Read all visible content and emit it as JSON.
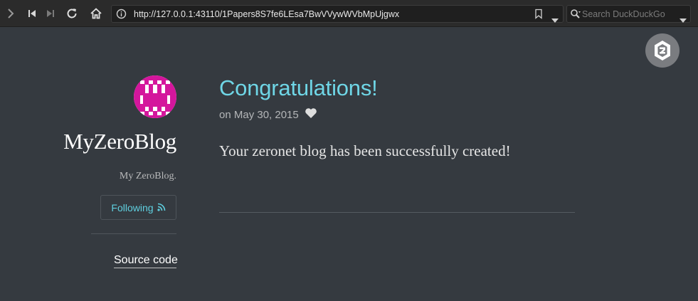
{
  "browser": {
    "url": "http://127.0.0.1:43110/1Papers8S7fe6LEsa7BwVVywWVbMpUjgwx",
    "search_placeholder": "Search DuckDuckGo"
  },
  "blog": {
    "title": "MyZeroBlog",
    "description": "My ZeroBlog.",
    "follow_label": "Following",
    "source_link": "Source code"
  },
  "post": {
    "title": "Congratulations!",
    "date": "on May 30, 2015",
    "body": "Your zeronet blog has been successfully created!"
  },
  "colors": {
    "background": "#353a40",
    "accent": "#6fd6e6",
    "avatar": "#d4169c"
  }
}
